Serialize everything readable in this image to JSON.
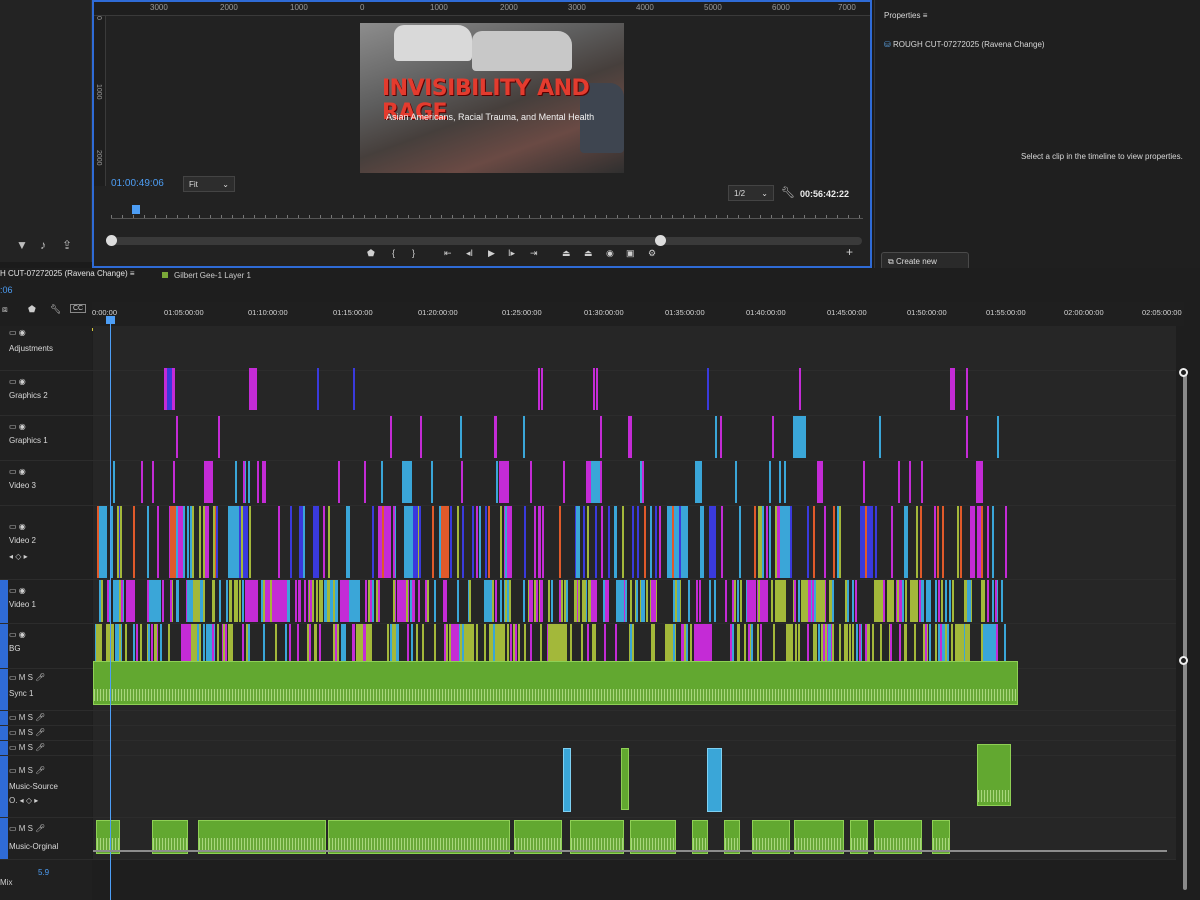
{
  "program_monitor": {
    "ruler_labels": [
      "3000",
      "2000",
      "1000",
      "0",
      "1000",
      "2000",
      "3000",
      "4000",
      "5000",
      "6000",
      "7000"
    ],
    "vruler_labels": [
      "0",
      "1000",
      "2000"
    ],
    "preview_title": "INVISIBILITY AND RAGE",
    "preview_subtitle": "Asian Americans, Racial Trauma, and Mental Health",
    "current_timecode": "01:00:49:06",
    "zoom_select": "Fit",
    "resolution_select": "1/2",
    "duration_timecode": "00:56:42:22",
    "transport": [
      "marker-icon",
      "in-point-icon",
      "out-point-icon",
      "go-to-in-icon",
      "step-back-icon",
      "play-icon",
      "step-forward-icon",
      "go-to-out-icon",
      "lift-icon",
      "extract-icon",
      "export-frame-icon",
      "comparison-view-icon",
      "settings-icon",
      "add-icon"
    ]
  },
  "properties": {
    "title": "Properties",
    "sequence_name": "ROUGH CUT-07272025 (Ravena Change)",
    "message": "Select a clip in the timeline to view properties.",
    "create_graphic": "Create new graphic"
  },
  "timeline": {
    "sequence_tab": "H CUT-07272025 (Ravena Change)",
    "second_tab": "Gilbert Gee-1 Layer 1",
    "timecode": ":06",
    "ruler_labels": [
      "0:00:00",
      "01:05:00:00",
      "01:10:00:00",
      "01:15:00:00",
      "01:20:00:00",
      "01:25:00:00",
      "01:30:00:00",
      "01:35:00:00",
      "01:40:00:00",
      "01:45:00:00",
      "01:50:00:00",
      "01:55:00:00",
      "02:00:00:00",
      "02:05:00:00"
    ],
    "tracks": [
      {
        "name": "Adjustments",
        "id": ""
      },
      {
        "name": "Graphics 2",
        "id": "5"
      },
      {
        "name": "Graphics 1",
        "id": "5"
      },
      {
        "name": "Video 3",
        "id": "4"
      },
      {
        "name": "Video 2",
        "id": "3"
      },
      {
        "name": "Video 1",
        "id": "2"
      },
      {
        "name": "BG",
        "id": "1"
      },
      {
        "name": "Sync 1",
        "id": "1"
      },
      {
        "name": "",
        "id": "2"
      },
      {
        "name": "",
        "id": "3"
      },
      {
        "name": "",
        "id": "4"
      },
      {
        "name": "Music-Source",
        "id": "5"
      },
      {
        "name": "Music-Orginal",
        "id": "6"
      }
    ],
    "mix_label": "Mix",
    "mix_value": "5.9"
  },
  "colors": {
    "accent_blue": "#2f6bd6",
    "clip_green": "#62a830",
    "clip_lime": "#a3b83a",
    "clip_magenta": "#c42bd6",
    "clip_cyan": "#3aa6d8",
    "work_area": "#d4c83a"
  }
}
